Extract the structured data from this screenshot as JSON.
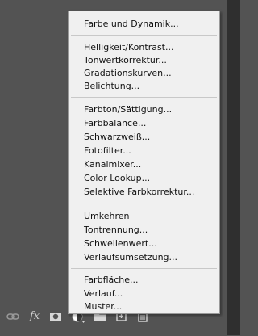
{
  "menu": {
    "groups": [
      {
        "items": [
          "Farbe und Dynamik..."
        ]
      },
      {
        "items": [
          "Helligkeit/Kontrast...",
          "Tonwertkorrektur...",
          "Gradationskurven...",
          "Belichtung..."
        ]
      },
      {
        "items": [
          "Farbton/Sättigung...",
          "Farbbalance...",
          "Schwarzweiß...",
          "Fotofilter...",
          "Kanalmixer...",
          "Color Lookup...",
          "Selektive Farbkorrektur..."
        ]
      },
      {
        "items": [
          "Umkehren",
          "Tontrennung...",
          "Schwellenwert...",
          "Verlaufsumsetzung..."
        ]
      },
      {
        "items": [
          "Farbfläche...",
          "Verlauf...",
          "Muster..."
        ]
      }
    ]
  },
  "bottom_bar": {
    "icons": [
      "link-icon",
      "fx-icon",
      "mask-icon",
      "adjustment-layer-icon",
      "group-folder-icon",
      "new-layer-icon",
      "trash-icon"
    ],
    "fx_label": "fx"
  },
  "colors": {
    "panel": "#535353",
    "menu_bg": "#f0f0f0",
    "menu_text": "#111111"
  }
}
